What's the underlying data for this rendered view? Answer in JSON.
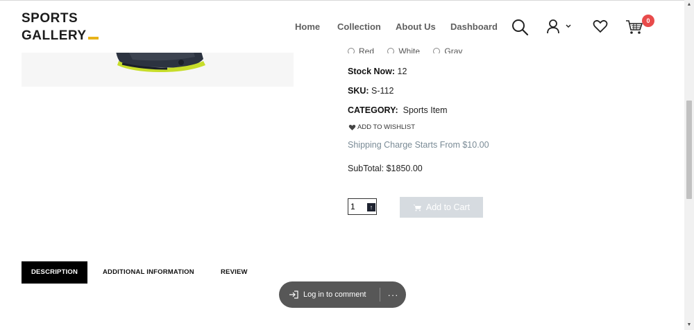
{
  "header": {
    "logo_line1": "SPORTS",
    "logo_line2": "GALLERY",
    "nav": [
      "Home",
      "Collection",
      "About Us",
      "Dashboard"
    ],
    "cart_count": "0",
    "accent_color": "#e8b31a",
    "badge_color": "#e84b4b"
  },
  "product": {
    "colors": [
      "Red",
      "White",
      "Gray"
    ],
    "stock_label": "Stock Now:",
    "stock_value": "12",
    "sku_label": "SKU:",
    "sku_value": "S-112",
    "category_label": "CATEGORY:",
    "category_value": "Sports Item",
    "wishlist_label": "ADD TO WISHLIST",
    "shipping_text": "Shipping Charge Starts From $10.00",
    "subtotal_text": "SubTotal: $1850.00",
    "quantity": "1",
    "add_to_cart_label": "Add to Cart"
  },
  "tabs": [
    "DESCRIPTION",
    "ADDITIONAL INFORMATION",
    "REVIEW"
  ],
  "comment": {
    "login_label": "Log in to comment",
    "more_label": "···"
  },
  "scrollbar": {
    "up": "▲",
    "down": "▼"
  }
}
